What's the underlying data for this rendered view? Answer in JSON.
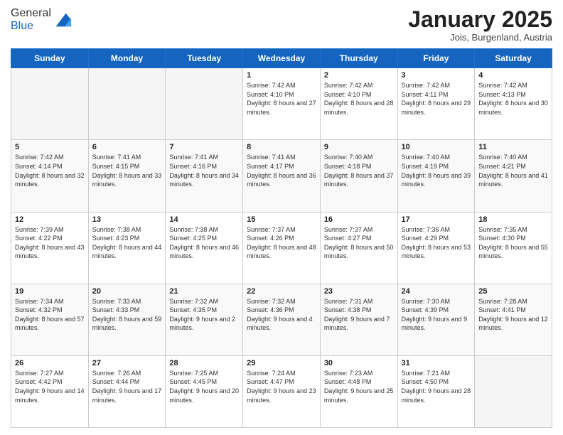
{
  "header": {
    "logo_general": "General",
    "logo_blue": "Blue",
    "month_title": "January 2025",
    "location": "Jois, Burgenland, Austria"
  },
  "days_of_week": [
    "Sunday",
    "Monday",
    "Tuesday",
    "Wednesday",
    "Thursday",
    "Friday",
    "Saturday"
  ],
  "weeks": [
    [
      {
        "day": "",
        "info": ""
      },
      {
        "day": "",
        "info": ""
      },
      {
        "day": "",
        "info": ""
      },
      {
        "day": "1",
        "info": "Sunrise: 7:42 AM\nSunset: 4:10 PM\nDaylight: 8 hours and 27 minutes."
      },
      {
        "day": "2",
        "info": "Sunrise: 7:42 AM\nSunset: 4:10 PM\nDaylight: 8 hours and 28 minutes."
      },
      {
        "day": "3",
        "info": "Sunrise: 7:42 AM\nSunset: 4:11 PM\nDaylight: 8 hours and 29 minutes."
      },
      {
        "day": "4",
        "info": "Sunrise: 7:42 AM\nSunset: 4:13 PM\nDaylight: 8 hours and 30 minutes."
      }
    ],
    [
      {
        "day": "5",
        "info": "Sunrise: 7:42 AM\nSunset: 4:14 PM\nDaylight: 8 hours and 32 minutes."
      },
      {
        "day": "6",
        "info": "Sunrise: 7:41 AM\nSunset: 4:15 PM\nDaylight: 8 hours and 33 minutes."
      },
      {
        "day": "7",
        "info": "Sunrise: 7:41 AM\nSunset: 4:16 PM\nDaylight: 8 hours and 34 minutes."
      },
      {
        "day": "8",
        "info": "Sunrise: 7:41 AM\nSunset: 4:17 PM\nDaylight: 8 hours and 36 minutes."
      },
      {
        "day": "9",
        "info": "Sunrise: 7:40 AM\nSunset: 4:18 PM\nDaylight: 8 hours and 37 minutes."
      },
      {
        "day": "10",
        "info": "Sunrise: 7:40 AM\nSunset: 4:19 PM\nDaylight: 8 hours and 39 minutes."
      },
      {
        "day": "11",
        "info": "Sunrise: 7:40 AM\nSunset: 4:21 PM\nDaylight: 8 hours and 41 minutes."
      }
    ],
    [
      {
        "day": "12",
        "info": "Sunrise: 7:39 AM\nSunset: 4:22 PM\nDaylight: 8 hours and 43 minutes."
      },
      {
        "day": "13",
        "info": "Sunrise: 7:38 AM\nSunset: 4:23 PM\nDaylight: 8 hours and 44 minutes."
      },
      {
        "day": "14",
        "info": "Sunrise: 7:38 AM\nSunset: 4:25 PM\nDaylight: 8 hours and 46 minutes."
      },
      {
        "day": "15",
        "info": "Sunrise: 7:37 AM\nSunset: 4:26 PM\nDaylight: 8 hours and 48 minutes."
      },
      {
        "day": "16",
        "info": "Sunrise: 7:37 AM\nSunset: 4:27 PM\nDaylight: 8 hours and 50 minutes."
      },
      {
        "day": "17",
        "info": "Sunrise: 7:36 AM\nSunset: 4:29 PM\nDaylight: 8 hours and 53 minutes."
      },
      {
        "day": "18",
        "info": "Sunrise: 7:35 AM\nSunset: 4:30 PM\nDaylight: 8 hours and 55 minutes."
      }
    ],
    [
      {
        "day": "19",
        "info": "Sunrise: 7:34 AM\nSunset: 4:32 PM\nDaylight: 8 hours and 57 minutes."
      },
      {
        "day": "20",
        "info": "Sunrise: 7:33 AM\nSunset: 4:33 PM\nDaylight: 8 hours and 59 minutes."
      },
      {
        "day": "21",
        "info": "Sunrise: 7:32 AM\nSunset: 4:35 PM\nDaylight: 9 hours and 2 minutes."
      },
      {
        "day": "22",
        "info": "Sunrise: 7:32 AM\nSunset: 4:36 PM\nDaylight: 9 hours and 4 minutes."
      },
      {
        "day": "23",
        "info": "Sunrise: 7:31 AM\nSunset: 4:38 PM\nDaylight: 9 hours and 7 minutes."
      },
      {
        "day": "24",
        "info": "Sunrise: 7:30 AM\nSunset: 4:39 PM\nDaylight: 9 hours and 9 minutes."
      },
      {
        "day": "25",
        "info": "Sunrise: 7:28 AM\nSunset: 4:41 PM\nDaylight: 9 hours and 12 minutes."
      }
    ],
    [
      {
        "day": "26",
        "info": "Sunrise: 7:27 AM\nSunset: 4:42 PM\nDaylight: 9 hours and 14 minutes."
      },
      {
        "day": "27",
        "info": "Sunrise: 7:26 AM\nSunset: 4:44 PM\nDaylight: 9 hours and 17 minutes."
      },
      {
        "day": "28",
        "info": "Sunrise: 7:25 AM\nSunset: 4:45 PM\nDaylight: 9 hours and 20 minutes."
      },
      {
        "day": "29",
        "info": "Sunrise: 7:24 AM\nSunset: 4:47 PM\nDaylight: 9 hours and 23 minutes."
      },
      {
        "day": "30",
        "info": "Sunrise: 7:23 AM\nSunset: 4:48 PM\nDaylight: 9 hours and 25 minutes."
      },
      {
        "day": "31",
        "info": "Sunrise: 7:21 AM\nSunset: 4:50 PM\nDaylight: 9 hours and 28 minutes."
      },
      {
        "day": "",
        "info": ""
      }
    ]
  ]
}
